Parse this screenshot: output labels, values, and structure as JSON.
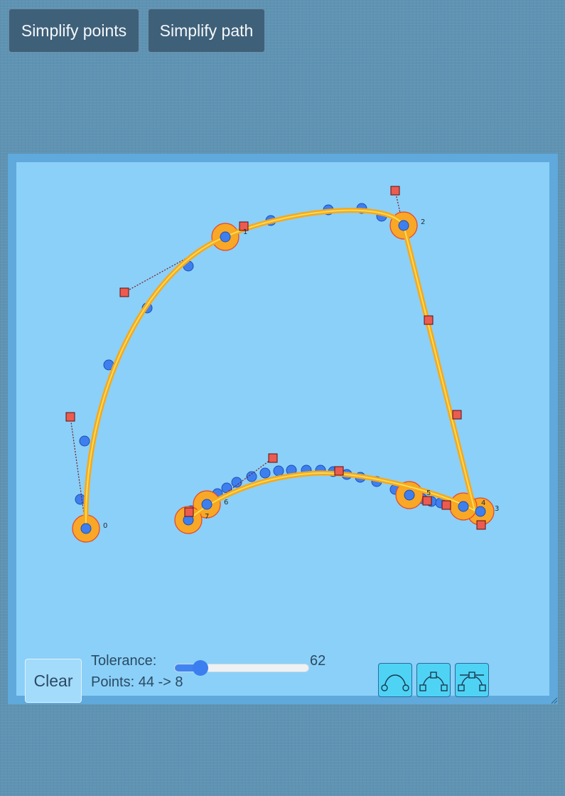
{
  "toolbar": {
    "simplify_points_label": "Simplify points",
    "simplify_path_label": "Simplify path"
  },
  "canvas": {
    "background_color": "#8bd0f8",
    "curve_color": "#f7a81b",
    "curve_highlight": "#f8dc5a",
    "raw_point_fill": "#3e7ff0",
    "anchor_fill": "#f8a826",
    "anchor_stroke": "#e8432c",
    "handle_fill": "#ec5b4f",
    "anchor_labels": [
      "0",
      "2",
      "3",
      "4",
      "5",
      "6",
      "7"
    ],
    "handle_label": "1"
  },
  "controls": {
    "clear_label": "Clear",
    "tolerance_label": "Tolerance:",
    "tolerance_value": "62",
    "tolerance_fraction": 0.19,
    "points_text": "Points: 44 -> 8",
    "mode_buttons": [
      "smooth-curve-icon",
      "corner-handles-icon",
      "tangent-handles-icon"
    ]
  }
}
